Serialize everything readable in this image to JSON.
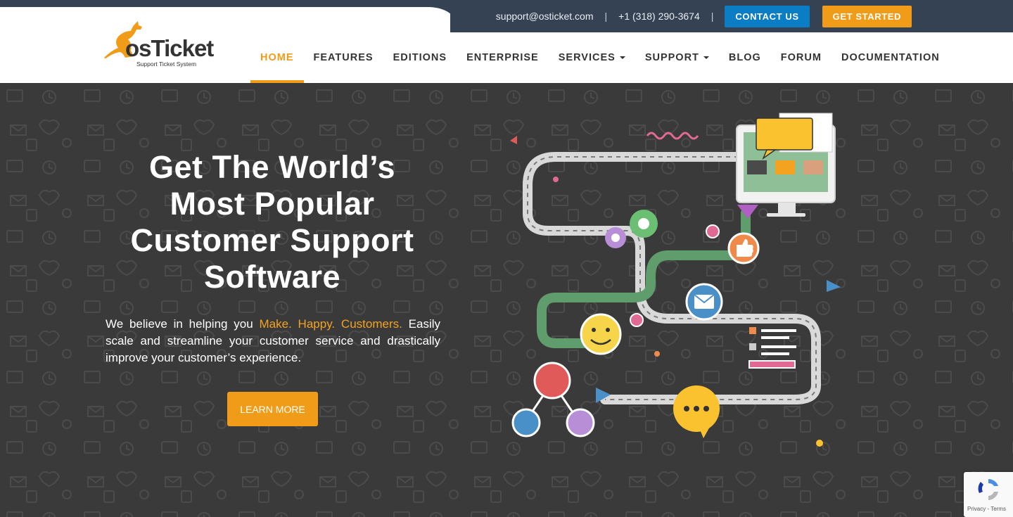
{
  "topbar": {
    "email": "support@osticket.com",
    "separator": "|",
    "phone": "+1 (318) 290-3674",
    "contact_label": "CONTACT US",
    "start_label": "GET STARTED"
  },
  "logo": {
    "wordmark": "osTicket",
    "tagline": "Support Ticket System"
  },
  "nav": {
    "items": [
      {
        "label": "HOME",
        "active": true,
        "dropdown": false
      },
      {
        "label": "FEATURES",
        "active": false,
        "dropdown": false
      },
      {
        "label": "EDITIONS",
        "active": false,
        "dropdown": false
      },
      {
        "label": "ENTERPRISE",
        "active": false,
        "dropdown": false
      },
      {
        "label": "SERVICES",
        "active": false,
        "dropdown": true
      },
      {
        "label": "SUPPORT",
        "active": false,
        "dropdown": true
      },
      {
        "label": "BLOG",
        "active": false,
        "dropdown": false
      },
      {
        "label": "FORUM",
        "active": false,
        "dropdown": false
      },
      {
        "label": "DOCUMENTATION",
        "active": false,
        "dropdown": false
      }
    ]
  },
  "hero": {
    "title_lines": [
      "Get The World’s",
      "Most Popular",
      "Customer Support",
      "Software"
    ],
    "text_before": "We believe in helping you ",
    "text_highlight": "Make. Happy. Customers.",
    "text_after": " Easily scale and streamline your customer service and drastically improve your customer’s experience.",
    "button_label": "LEARN MORE"
  },
  "recaptcha": {
    "text": "Privacy - Terms"
  },
  "colors": {
    "accent": "#f19c19",
    "contact_blue": "#0b7dc4",
    "topbar_dark": "#354254",
    "hero_bg": "#3a3a3a"
  }
}
